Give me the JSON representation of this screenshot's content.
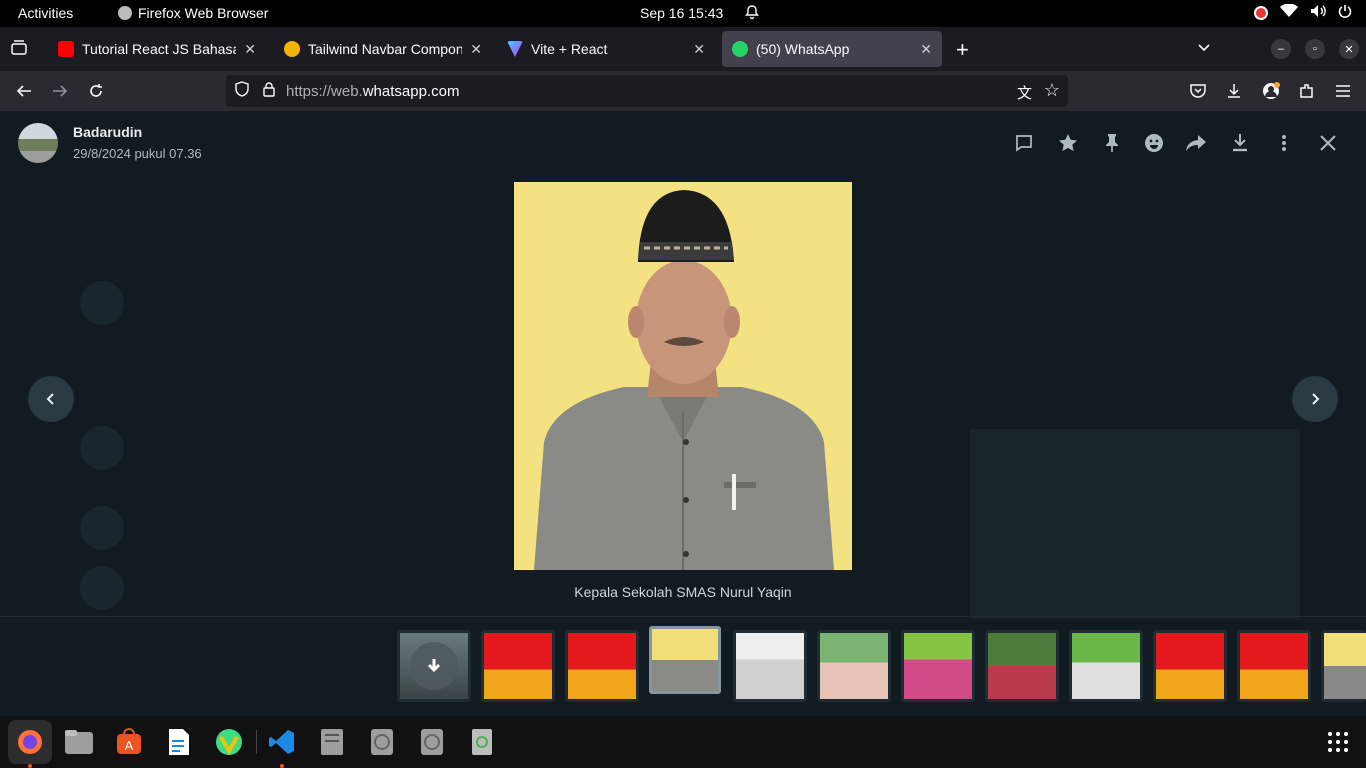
{
  "system": {
    "activities": "Activities",
    "app_name": "Firefox Web Browser",
    "clock": "Sep 16  15:43"
  },
  "tabs": [
    {
      "label": "Tutorial React JS Bahasa",
      "favicon_color": "#ff0000",
      "active": false
    },
    {
      "label": "Tailwind Navbar Compon",
      "favicon_color": "#f4b400",
      "active": false
    },
    {
      "label": "Vite + React",
      "favicon_color": "#8f6cff",
      "active": false
    },
    {
      "label": "(50) WhatsApp",
      "favicon_color": "#25d366",
      "active": true
    }
  ],
  "url": {
    "prefix": "https://web.",
    "domain": "whatsapp.com"
  },
  "viewer": {
    "sender": "Badarudin",
    "timestamp": "29/8/2024 pukul 07.36",
    "caption": "Kepala Sekolah SMAS Nurul Yaqin",
    "header_icons": [
      "reply-icon",
      "star-icon",
      "pin-icon",
      "emoji-icon",
      "forward-icon",
      "download-icon",
      "more-icon",
      "close-icon"
    ]
  },
  "thumbnails": [
    {
      "name": "thumb-download-placeholder",
      "colors": [
        "#6b7a80",
        "#3a4448"
      ]
    },
    {
      "name": "thumb-man-red",
      "colors": [
        "#e3191b",
        "#f2a51a"
      ]
    },
    {
      "name": "thumb-woman-red",
      "colors": [
        "#e3191b",
        "#f2a51a"
      ]
    },
    {
      "name": "thumb-principal",
      "colors": [
        "#f2df7a",
        "#777"
      ],
      "selected": true
    },
    {
      "name": "thumb-elder",
      "colors": [
        "#e8e8e8",
        "#bbb"
      ]
    },
    {
      "name": "thumb-group-1",
      "colors": [
        "#7bb372",
        "#e8c3b7"
      ]
    },
    {
      "name": "thumb-group-2",
      "colors": [
        "#86c443",
        "#d24a86"
      ]
    },
    {
      "name": "thumb-group-3",
      "colors": [
        "#4d7c3a",
        "#b93a4b"
      ]
    },
    {
      "name": "thumb-building",
      "colors": [
        "#6cb74a",
        "#e0e0e0"
      ]
    },
    {
      "name": "thumb-man-red-2",
      "colors": [
        "#e3191b",
        "#f2a51a"
      ]
    },
    {
      "name": "thumb-woman-red-2",
      "colors": [
        "#e3191b",
        "#f2a51a"
      ]
    },
    {
      "name": "thumb-partial",
      "colors": [
        "#f2df7a",
        "#888"
      ]
    }
  ],
  "dock": [
    "firefox-icon",
    "files-icon",
    "app-center-icon",
    "writer-icon",
    "android-studio-icon",
    "vscode-icon",
    "disk-icon",
    "drive-icon",
    "drive-icon-2",
    "trash-icon"
  ]
}
